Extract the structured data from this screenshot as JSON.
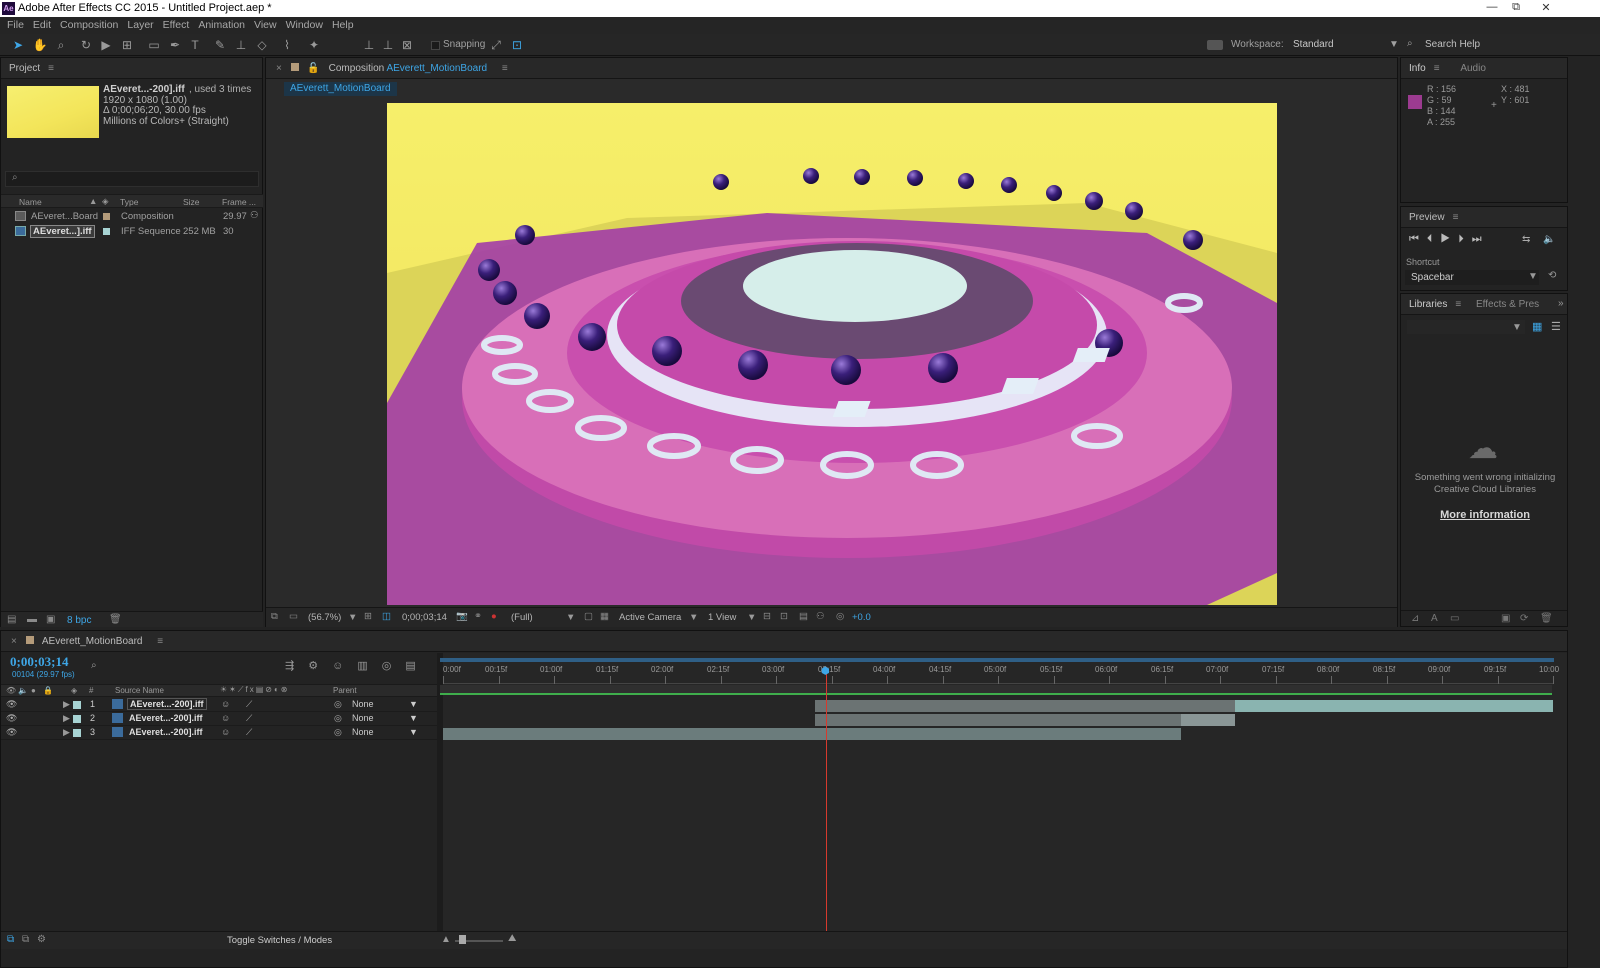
{
  "window": {
    "title": "Adobe After Effects CC 2015 - Untitled Project.aep *",
    "logo": "Ae",
    "min": "▭",
    "max": "⧉",
    "close": "✕"
  },
  "menu": [
    "File",
    "Edit",
    "Composition",
    "Layer",
    "Effect",
    "Animation",
    "View",
    "Window",
    "Help"
  ],
  "toolbar": {
    "snapping": "Snapping",
    "workspace_label": "Workspace:",
    "workspace": "Standard",
    "search": "Search Help"
  },
  "project": {
    "title": "Project",
    "selected_name": "AEveret...-200].iff",
    "used": ", used 3 times",
    "dims": "1920 x 1080 (1.00)",
    "duration": "Δ 0;00;06;20, 30.00 fps",
    "colors": "Millions of Colors+ (Straight)",
    "columns": [
      "Name",
      "Type",
      "Size",
      "Frame ..."
    ],
    "items": [
      {
        "name": "AEveret...Board",
        "type": "Composition",
        "size": "",
        "frame": "29.97"
      },
      {
        "name": "AEveret...].iff",
        "type": "IFF Sequence",
        "size": "252 MB",
        "frame": "30"
      }
    ],
    "bpc": "8 bpc"
  },
  "composition": {
    "panel_label": "Composition",
    "name": "AEverett_MotionBoard",
    "tab": "AEverett_MotionBoard",
    "zoom": "(56.7%)",
    "timecode": "0;00;03;14",
    "resolution": "(Full)",
    "camera": "Active Camera",
    "view": "1 View",
    "exposure": "+0.0"
  },
  "info": {
    "tab_info": "Info",
    "tab_audio": "Audio",
    "r": "R : 156",
    "g": "G : 59",
    "b": "B : 144",
    "a": "A : 255",
    "x": "X : 481",
    "y": "Y : 601",
    "swatch": "#9c3b90"
  },
  "preview": {
    "title": "Preview",
    "shortcut_label": "Shortcut",
    "shortcut": "Spacebar"
  },
  "libraries": {
    "title": "Libraries",
    "tab2": "Effects & Pres",
    "error": "Something went wrong initializing Creative Cloud Libraries",
    "link": "More information"
  },
  "timeline": {
    "comp": "AEverett_MotionBoard",
    "timecode": "0;00;03;14",
    "frames": "00104 (29.97 fps)",
    "col_num": "#",
    "col_source": "Source Name",
    "col_parent": "Parent",
    "rulers": [
      "0:00f",
      "00:15f",
      "01:00f",
      "01:15f",
      "02:00f",
      "02:15f",
      "03:00f",
      "03:15f",
      "04:00f",
      "04:15f",
      "05:00f",
      "05:15f",
      "06:00f",
      "06:15f",
      "07:00f",
      "07:15f",
      "08:00f",
      "08:15f",
      "09:00f",
      "09:15f",
      "10:00"
    ],
    "layers": [
      {
        "num": "1",
        "name": "AEveret...-200].iff",
        "parent": "None"
      },
      {
        "num": "2",
        "name": "AEveret...-200].iff",
        "parent": "None"
      },
      {
        "num": "3",
        "name": "AEveret...-200].iff",
        "parent": "None"
      }
    ],
    "toggle": "Toggle Switches / Modes"
  }
}
